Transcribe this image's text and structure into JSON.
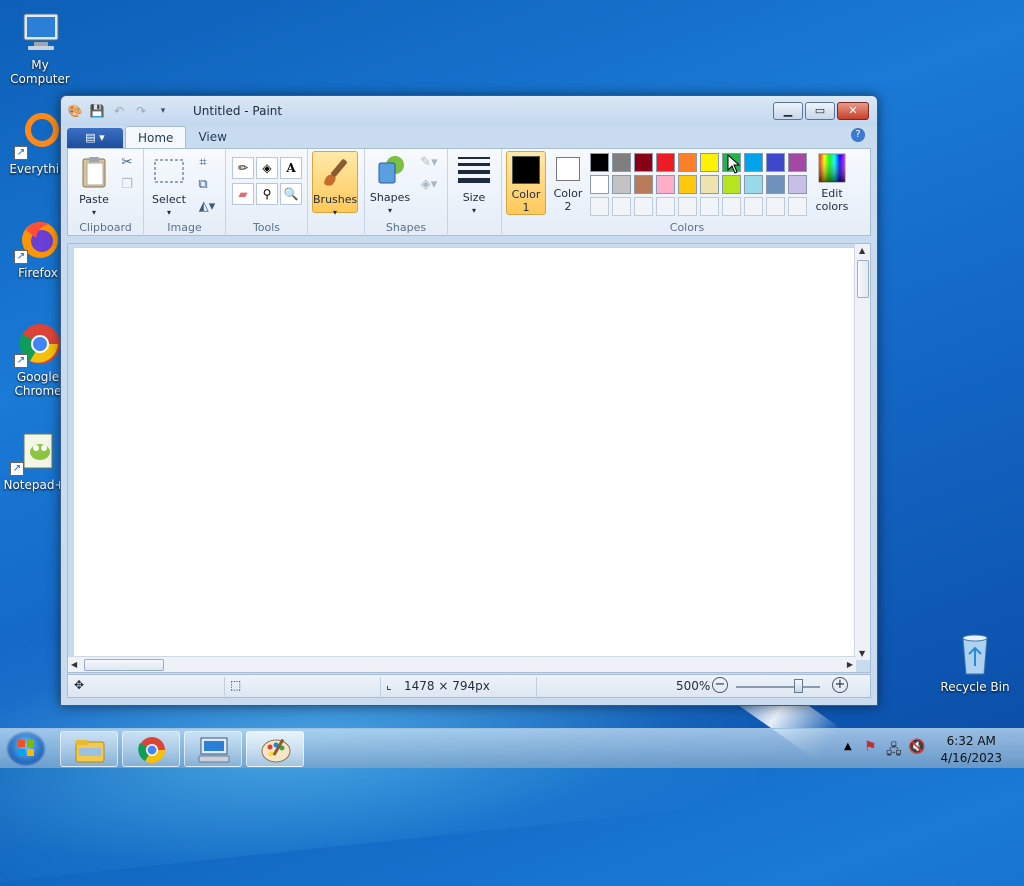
{
  "desktop": {
    "icons": [
      {
        "label": "My Computer"
      },
      {
        "label": "Everythin"
      },
      {
        "label": "Firefox"
      },
      {
        "label": "Google Chrome"
      },
      {
        "label": "Notepad+"
      },
      {
        "label": "Recycle Bin"
      }
    ]
  },
  "window": {
    "title": "Untitled - Paint",
    "file_menu_glyph": "▤ ▾",
    "tabs": [
      {
        "label": "Home"
      },
      {
        "label": "View"
      }
    ],
    "help_glyph": "?"
  },
  "ribbon": {
    "groups": {
      "clipboard": "Clipboard",
      "image": "Image",
      "tools": "Tools",
      "shapes": "Shapes",
      "colors": "Colors"
    },
    "paste_label": "Paste",
    "select_label": "Select",
    "brushes_label": "Brushes",
    "shapes_label": "Shapes",
    "size_label": "Size",
    "color1_label": "Color\n1",
    "color2_label": "Color\n2",
    "edit_colors_label": "Edit\ncolors",
    "color1_value": "#000000",
    "color2_value": "#ffffff",
    "palette_row1": [
      "#000000",
      "#7f7f7f",
      "#880015",
      "#ed1c24",
      "#ff7f27",
      "#fff200",
      "#22b14c",
      "#00a2e8",
      "#3f48cc",
      "#a349a4"
    ],
    "palette_row2": [
      "#ffffff",
      "#c3c3c3",
      "#b97a57",
      "#ffaec9",
      "#ffc90e",
      "#efe4b0",
      "#b5e61d",
      "#99d9ea",
      "#7092be",
      "#c8bfe7"
    ]
  },
  "statusbar": {
    "dimensions": "1478 × 794px",
    "zoom": "500%"
  },
  "taskbar": {
    "time": "6:32 AM",
    "date": "4/16/2023"
  }
}
